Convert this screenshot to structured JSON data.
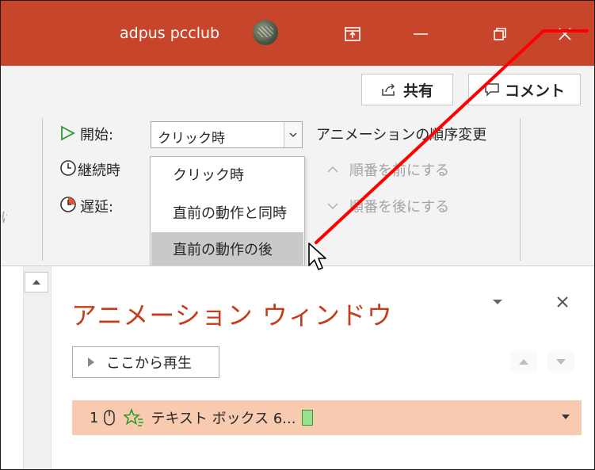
{
  "titlebar": {
    "user_name": "adpus pcclub",
    "colors": {
      "bar": "#c6452b"
    }
  },
  "ribbon": {
    "share_label": "共有",
    "comment_label": "コメント",
    "start_label": "開始:",
    "start_value": "クリック時",
    "duration_label": "継続時",
    "delay_label": "遅延:",
    "reorder_title": "アニメーションの順序変更",
    "move_earlier_label": "順番を前にする",
    "move_later_label": "順番を後にする",
    "cut_text": "け"
  },
  "start_menu": {
    "items": [
      "クリック時",
      "直前の動作と同時",
      "直前の動作の後"
    ],
    "highlighted_index": 2
  },
  "pane": {
    "title": "アニメーション ウィンドウ",
    "play_label": "ここから再生",
    "item": {
      "number": "1",
      "text": "テキスト ボックス 6..."
    },
    "colors": {
      "title": "#c43e1c",
      "row_bg": "#f8cbb0"
    }
  },
  "icons": [
    "play-triangle-icon",
    "clock-icon",
    "delay-clock-icon",
    "share-icon",
    "comment-icon",
    "mouse-icon",
    "star-effect-icon",
    "cursor-pointer-icon"
  ],
  "annotation_color": "#ff0000"
}
